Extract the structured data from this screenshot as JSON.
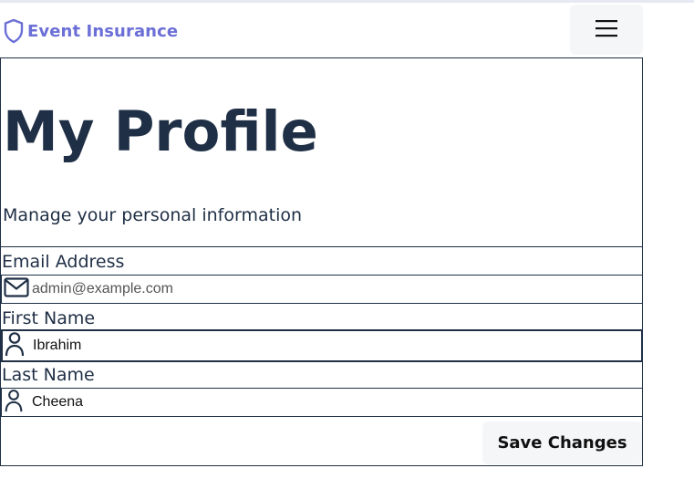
{
  "brand": {
    "name": "Event Insurance",
    "color": "#6b6fd6"
  },
  "icons": {
    "brand": "shield-icon",
    "menu": "hamburger-menu-icon",
    "email": "mail-icon",
    "person": "user-icon"
  },
  "header": {
    "title": "My Profile",
    "subtitle": "Manage your personal information"
  },
  "form": {
    "email": {
      "label": "Email Address",
      "value": "",
      "placeholder": "admin@example.com"
    },
    "first_name": {
      "label": "First Name",
      "value": "Ibrahim"
    },
    "last_name": {
      "label": "Last Name",
      "value": "Cheena"
    },
    "save_label": "Save Changes"
  },
  "colors": {
    "text": "#1f2f45",
    "button_bg": "#f5f6f8"
  }
}
